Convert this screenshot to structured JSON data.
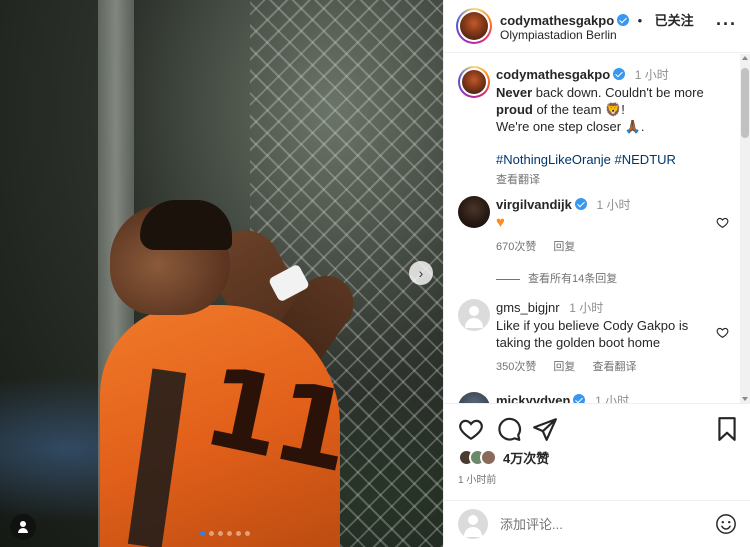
{
  "post": {
    "carousel_dots": 6,
    "active_dot": 0
  },
  "header": {
    "username": "codymathesgakpo",
    "follow_label": "已关注",
    "separator": "•",
    "location": "Olympiastadion Berlin",
    "more_label": "···"
  },
  "caption": {
    "username": "codymathesgakpo",
    "time": "1 小时",
    "line1_bold": "Never",
    "line1_rest": " back down. Couldn't be more",
    "line2_bold": "proud",
    "line2_rest": " of the team 🦁!",
    "line3": "We're one step closer 🙏🏾.",
    "hashtags": "#NothingLikeOranje #NEDTUR",
    "translate": "查看翻译"
  },
  "comments": [
    {
      "username": "virgilvandijk",
      "time": "1 小时",
      "text": "♥",
      "likes": "670次赞",
      "reply": "回复",
      "view_replies": "查看所有14条回复"
    },
    {
      "username": "gms_bigjnr",
      "time": "1 小时",
      "text": "Like if you believe Cody Gakpo is taking the golden boot home",
      "likes": "350次赞",
      "reply": "回复",
      "translate": "查看翻译"
    },
    {
      "username": "mickyvdven",
      "time": "1 小时"
    }
  ],
  "actions": {
    "likes_count": "4万次赞",
    "posted": "1 小时前"
  },
  "comment_box": {
    "placeholder": "添加评论..."
  },
  "colors": {
    "verified": "#3897f0",
    "hashtag": "#00376b",
    "muted": "#737373",
    "carousel_active": "#2f80ed"
  }
}
